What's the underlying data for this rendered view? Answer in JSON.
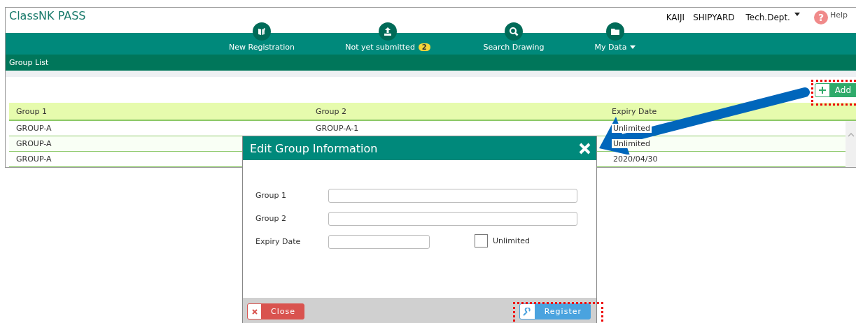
{
  "app": {
    "title": "ClassNK PASS"
  },
  "user": {
    "company": "KAIJI　SHIPYARD",
    "department": "Tech.Dept."
  },
  "help": {
    "icon": "?",
    "label": "Help"
  },
  "nav": [
    {
      "kind": "registration",
      "label": "New Registration"
    },
    {
      "kind": "upload",
      "label": "Not yet submitted",
      "badge": "2"
    },
    {
      "kind": "search",
      "label": "Search Drawing"
    },
    {
      "kind": "folder",
      "label": "My Data",
      "dropdown": true
    }
  ],
  "section_title": "Group List",
  "add_button": {
    "label": "Add"
  },
  "table": {
    "columns": [
      "Group 1",
      "Group 2",
      "Expiry Date"
    ],
    "rows": [
      {
        "cells": [
          "GROUP-A",
          "GROUP-A-1",
          "Unlimited"
        ]
      },
      {
        "cells": [
          "GROUP-A",
          null,
          "Unlimited"
        ]
      },
      {
        "cells": [
          "GROUP-A",
          null,
          "2020/04/30"
        ]
      }
    ]
  },
  "dialog": {
    "title": "Edit Group Information",
    "fields": [
      {
        "kind": "text",
        "label": "Group 1"
      },
      {
        "kind": "text",
        "label": "Group 2"
      },
      {
        "kind": "date",
        "label": "Expiry Date"
      }
    ],
    "checkbox": {
      "label": "Unlimited",
      "checked": false
    },
    "close_button": "Close",
    "register_button": "Register"
  }
}
